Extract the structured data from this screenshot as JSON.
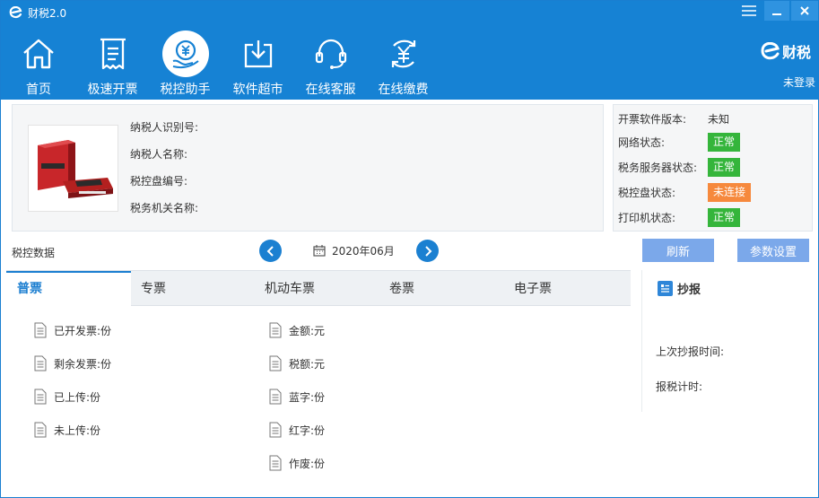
{
  "window": {
    "title": "财税2.0",
    "brand": "财税",
    "login": "未登录"
  },
  "nav": [
    {
      "label": "首页",
      "icon": "home-icon"
    },
    {
      "label": "极速开票",
      "icon": "receipt-icon"
    },
    {
      "label": "税控助手",
      "icon": "tax-assistant-icon",
      "active": true
    },
    {
      "label": "软件超市",
      "icon": "download-icon"
    },
    {
      "label": "在线客服",
      "icon": "headset-icon"
    },
    {
      "label": "在线缴费",
      "icon": "yen-refresh-icon"
    }
  ],
  "taxpayer": {
    "id_label": "纳税人识别号:",
    "name_label": "纳税人名称:",
    "disk_label": "税控盘编号:",
    "authority_label": "税务机关名称:"
  },
  "status": {
    "version_label": "开票软件版本:",
    "version_value": "未知",
    "network_label": "网络状态:",
    "network_value": "正常",
    "server_label": "税务服务器状态:",
    "server_value": "正常",
    "disk_label": "税控盘状态:",
    "disk_value": "未连接",
    "printer_label": "打印机状态:",
    "printer_value": "正常"
  },
  "taxdata": {
    "label": "税控数据",
    "month": "2020年06月",
    "refresh": "刷新",
    "settings": "参数设置"
  },
  "tabs": [
    "普票",
    "专票",
    "机动车票",
    "卷票",
    "电子票"
  ],
  "stats_left": [
    "已开发票:份",
    "剩余发票:份",
    "已上传:份",
    "未上传:份"
  ],
  "stats_right": [
    "金额:元",
    "税额:元",
    "蓝字:份",
    "红字:份",
    "作废:份"
  ],
  "report": {
    "title": "抄报",
    "last_time": "上次抄报时间:",
    "timer": "报税计时:"
  },
  "colors": {
    "header": "#1682d4",
    "ok": "#35b53b",
    "warn": "#f6893d",
    "button": "#7ba8ea"
  }
}
